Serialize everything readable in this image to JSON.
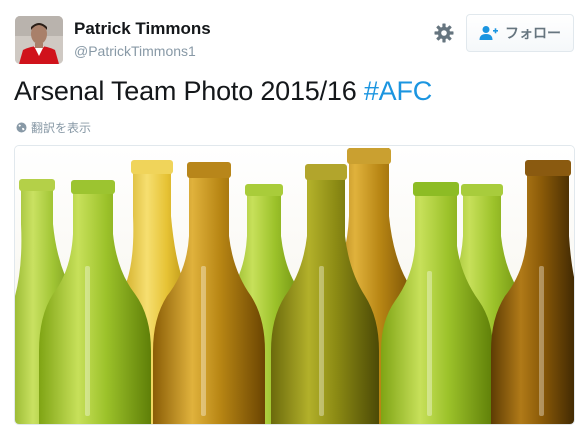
{
  "user": {
    "name": "Patrick Timmons",
    "handle": "@PatrickTimmons1"
  },
  "actions": {
    "follow_label": "フォロー"
  },
  "tweet": {
    "text": "Arsenal Team Photo 2015/16 ",
    "hashtag": "#AFC"
  },
  "translate": {
    "label": "翻訳を表示"
  },
  "media": {
    "icon": "photo-bottles"
  },
  "colors": {
    "hashtag": "#1b95e0",
    "secondary_text": "#8899a6"
  }
}
